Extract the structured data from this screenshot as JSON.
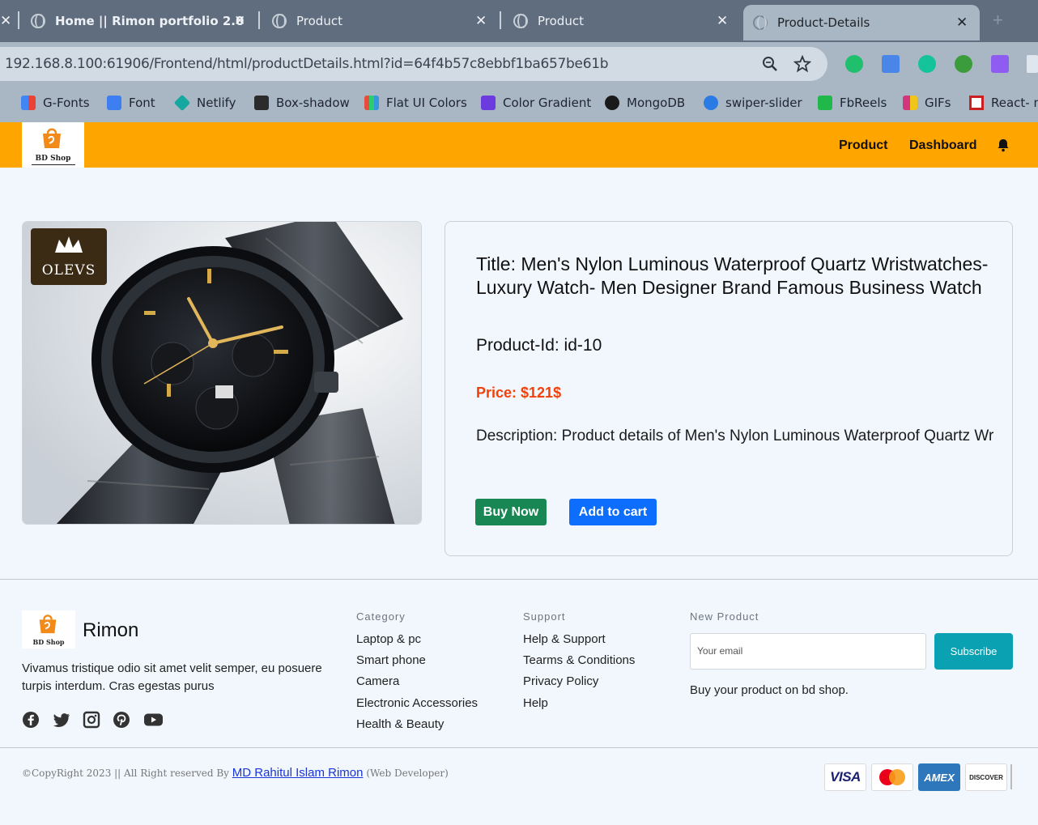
{
  "browser": {
    "tabs": [
      {
        "label": "Home || Rimon portfolio 2.0",
        "close": "✕"
      },
      {
        "label": "Product",
        "close": "✕"
      },
      {
        "label": "Product",
        "close": "✕"
      },
      {
        "label": "Product-Details",
        "close": "✕"
      }
    ],
    "new_tab": "+",
    "url": "192.168.8.100:61906/Frontend/html/productDetails.html?id=64f4b57c8ebbf1ba657be61b",
    "bookmarks": [
      {
        "label": "G-Fonts",
        "color": "#e74c3c"
      },
      {
        "label": "Font",
        "color": "#3d7ff0"
      },
      {
        "label": "Netlify",
        "color": "#15a8a0"
      },
      {
        "label": "Box-shadow",
        "color": "#2b2b2b"
      },
      {
        "label": "Flat UI Colors",
        "color": "#e67e22"
      },
      {
        "label": "Color Gradient",
        "color": "#6c3be0"
      },
      {
        "label": "MongoDB",
        "color": "#1a1a1a"
      },
      {
        "label": "swiper-slider",
        "color": "#2a7be4"
      },
      {
        "label": "FbReels",
        "color": "#20b84a"
      },
      {
        "label": "GIFs",
        "color": "#d3367b"
      },
      {
        "label": "React- np",
        "color": "#cc1f1f"
      }
    ]
  },
  "header": {
    "logo_text": "BD Shop",
    "nav": {
      "product": "Product",
      "dashboard": "Dashboard"
    }
  },
  "product": {
    "image_badge": "OLEVS",
    "title": "Title: Men's Nylon Luminous Waterproof Quartz Wristwatches- Luxury Watch- Men Designer Brand Famous Business Watch",
    "id": "Product-Id: id-10",
    "price": "Price: $121$",
    "description": "Description: Product details of Men's Nylon Luminous Waterproof Quartz Wristwatches- Luxury Watch- Men Designer Brand Famous Business Wat",
    "buy_label": "Buy Now",
    "cart_label": "Add to cart"
  },
  "footer": {
    "logo_text": "BD Shop",
    "brand": "Rimon",
    "about": "Vivamus tristique odio sit amet velit semper, eu posuere turpis interdum. Cras egestas purus",
    "category": {
      "heading": "Category",
      "items": [
        "Laptop & pc",
        "Smart phone",
        "Camera",
        "Electronic Accessories",
        "Health & Beauty"
      ]
    },
    "support": {
      "heading": "Support",
      "items": [
        "Help & Support",
        "Tearms & Conditions",
        "Privacy Policy",
        "Help"
      ]
    },
    "newsletter": {
      "heading": "New Product",
      "placeholder": "Your email",
      "button": "Subscribe",
      "note": "Buy your product on bd shop."
    },
    "copyright_prefix": "©CopyRight 2023 || All Right reserved By",
    "author": "MD Rahitul Islam Rimon",
    "role": "(Web Developer)",
    "cards": [
      "VISA",
      "Mastercard",
      "AMEX",
      "DISCOVER"
    ]
  },
  "colors": {
    "header": "#ffa500",
    "buy": "#198754",
    "cart": "#0d6efd",
    "price": "#f1420c",
    "subscribe": "#0aa1b3"
  }
}
